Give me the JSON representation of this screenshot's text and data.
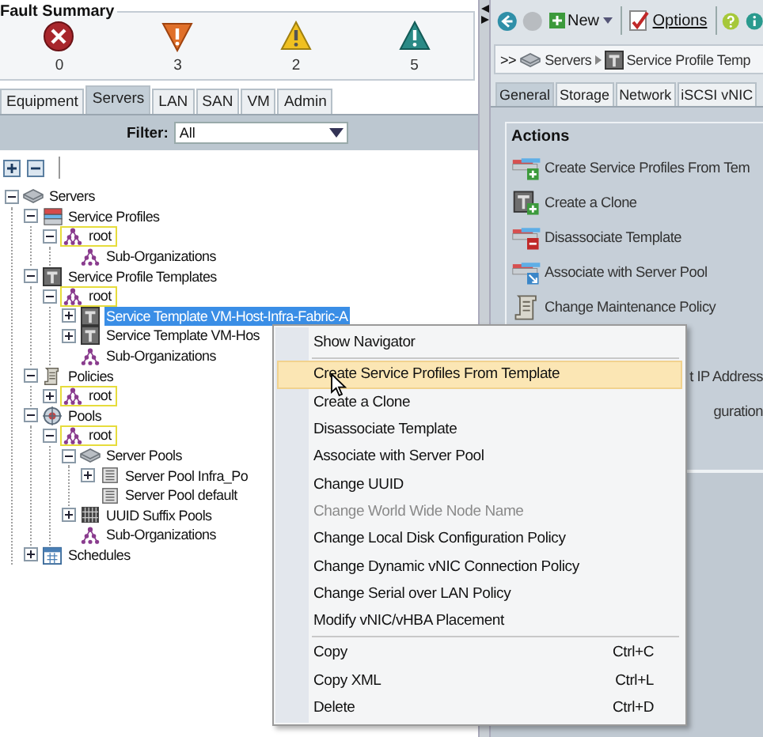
{
  "fault_summary": {
    "title": "Fault Summary",
    "faults": [
      {
        "kind": "critical",
        "count": "0"
      },
      {
        "kind": "major",
        "count": "3"
      },
      {
        "kind": "minor",
        "count": "2"
      },
      {
        "kind": "warning",
        "count": "5"
      }
    ]
  },
  "nav_tabs": [
    {
      "label": "Equipment",
      "selected": false
    },
    {
      "label": "Servers",
      "selected": true
    },
    {
      "label": "LAN",
      "selected": false
    },
    {
      "label": "SAN",
      "selected": false
    },
    {
      "label": "VM",
      "selected": false
    },
    {
      "label": "Admin",
      "selected": false
    }
  ],
  "filter": {
    "label": "Filter:",
    "value": "All"
  },
  "tree": [
    {
      "label": "Servers",
      "kind": "server",
      "expanded": true,
      "selected": false,
      "children": [
        {
          "label": "Service Profiles",
          "kind": "profiles",
          "expanded": true,
          "selected": false,
          "children": [
            {
              "label": "root",
              "kind": "org",
              "expanded": true,
              "selected": false,
              "children": [
                {
                  "label": "Sub-Organizations",
                  "kind": "suborg",
                  "selected": false
                }
              ]
            }
          ]
        },
        {
          "label": "Service Profile Templates",
          "kind": "template",
          "expanded": true,
          "selected": false,
          "children": [
            {
              "label": "root",
              "kind": "org",
              "expanded": true,
              "selected": false,
              "children": [
                {
                  "label": "Service Template VM-Host-Infra-Fabric-A",
                  "kind": "template",
                  "expanded": false,
                  "selected": true
                },
                {
                  "label": "Service Template VM-Hos",
                  "kind": "template",
                  "expanded": false,
                  "selected": false
                },
                {
                  "label": "Sub-Organizations",
                  "kind": "suborg",
                  "selected": false
                }
              ]
            }
          ]
        },
        {
          "label": "Policies",
          "kind": "policies",
          "expanded": true,
          "selected": false,
          "children": [
            {
              "label": "root",
              "kind": "org",
              "expanded": false,
              "selected": false
            }
          ]
        },
        {
          "label": "Pools",
          "kind": "pools",
          "expanded": true,
          "selected": false,
          "children": [
            {
              "label": "root",
              "kind": "org",
              "expanded": true,
              "selected": false,
              "children": [
                {
                  "label": "Server Pools",
                  "kind": "server",
                  "expanded": true,
                  "selected": false,
                  "children": [
                    {
                      "label": "Server Pool Infra_Po",
                      "kind": "pool",
                      "expanded": false,
                      "selected": false
                    },
                    {
                      "label": "Server Pool default",
                      "kind": "pool",
                      "selected": false
                    }
                  ]
                },
                {
                  "label": "UUID Suffix Pools",
                  "kind": "uuid",
                  "expanded": false,
                  "selected": false
                },
                {
                  "label": "Sub-Organizations",
                  "kind": "suborg",
                  "selected": false
                }
              ]
            }
          ]
        },
        {
          "label": "Schedules",
          "kind": "schedules",
          "expanded": false,
          "selected": false
        }
      ]
    }
  ],
  "toolbar": {
    "new_label": "New",
    "options_label": "Options"
  },
  "breadcrumb": {
    "prefix": ">>",
    "items": [
      {
        "label": "Servers",
        "kind": "server"
      },
      {
        "label": "Service Profile Temp",
        "kind": "template"
      }
    ]
  },
  "detail_tabs": [
    {
      "label": "General",
      "selected": true
    },
    {
      "label": "Storage",
      "selected": false
    },
    {
      "label": "Network",
      "selected": false
    },
    {
      "label": "iSCSI vNIC",
      "selected": false
    }
  ],
  "actions": {
    "title": "Actions",
    "items": [
      {
        "kind": "profile-add",
        "label": "Create Service Profiles From Tem"
      },
      {
        "kind": "template-add",
        "label": "Create a Clone"
      },
      {
        "kind": "profile-remove",
        "label": "Disassociate Template"
      },
      {
        "kind": "profile-link",
        "label": "Associate with Server Pool"
      },
      {
        "kind": "scroll",
        "label": "Change Maintenance Policy"
      },
      {
        "kind": "fragment",
        "label": "t IP Address"
      },
      {
        "kind": "fragment",
        "label": "guration"
      }
    ]
  },
  "context_menu": {
    "items": [
      {
        "kind": "item",
        "label": "Show Navigator",
        "highlighted": false,
        "disabled": false
      },
      {
        "kind": "separator"
      },
      {
        "kind": "item",
        "label": "Create Service Profiles From Template",
        "highlighted": true,
        "disabled": false
      },
      {
        "kind": "item",
        "label": "Create a Clone",
        "highlighted": false,
        "disabled": false
      },
      {
        "kind": "item",
        "label": "Disassociate Template",
        "highlighted": false,
        "disabled": false
      },
      {
        "kind": "item",
        "label": "Associate with Server Pool",
        "highlighted": false,
        "disabled": false
      },
      {
        "kind": "item",
        "label": "Change UUID",
        "highlighted": false,
        "disabled": false
      },
      {
        "kind": "item",
        "label": "Change World Wide Node Name",
        "highlighted": false,
        "disabled": true
      },
      {
        "kind": "item",
        "label": "Change Local Disk Configuration Policy",
        "highlighted": false,
        "disabled": false
      },
      {
        "kind": "item",
        "label": "Change Dynamic vNIC Connection Policy",
        "highlighted": false,
        "disabled": false
      },
      {
        "kind": "item",
        "label": "Change Serial over LAN Policy",
        "highlighted": false,
        "disabled": false
      },
      {
        "kind": "item",
        "label": "Modify vNIC/vHBA Placement",
        "highlighted": false,
        "disabled": false
      },
      {
        "kind": "separator"
      },
      {
        "kind": "item",
        "label": "Copy",
        "shortcut": "Ctrl+C",
        "highlighted": false,
        "disabled": false
      },
      {
        "kind": "item",
        "label": "Copy XML",
        "shortcut": "Ctrl+L",
        "highlighted": false,
        "disabled": false
      },
      {
        "kind": "item",
        "label": "Delete",
        "shortcut": "Ctrl+D",
        "highlighted": false,
        "disabled": false
      }
    ]
  }
}
